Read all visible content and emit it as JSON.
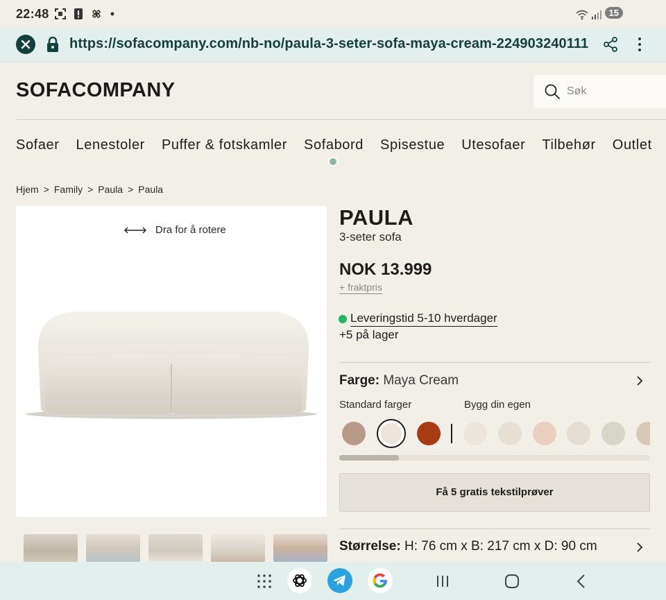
{
  "status": {
    "time": "22:48",
    "battery": "15"
  },
  "browser": {
    "url": "https://sofacompany.com/nb-no/paula-3-seter-sofa-maya-cream-224903240111"
  },
  "header": {
    "logo": "SOFACOMPANY",
    "search_placeholder": "Søk"
  },
  "nav": [
    "Sofaer",
    "Lenestoler",
    "Puffer & fotskamler",
    "Sofabord",
    "Spisestue",
    "Utesofaer",
    "Tilbehør",
    "Outlet"
  ],
  "breadcrumbs": [
    "Hjem",
    "Family",
    "Paula",
    "Paula"
  ],
  "gallery": {
    "rotate_hint": "Dra for å rotere"
  },
  "product": {
    "name": "PAULA",
    "subtitle": "3-seter sofa",
    "price": "NOK 13.999",
    "shipping": "+ fraktpris",
    "delivery": "Leveringstid 5-10 hverdager",
    "stock": "+5 på lager",
    "color_label": "Farge:",
    "color_value": "Maya Cream",
    "standard_colors_label": "Standard farger",
    "custom_colors_label": "Bygg din egen",
    "sample_button": "Få 5 gratis tekstilprøver",
    "size_label": "Størrelse:",
    "size_value": "H: 76 cm x B: 217 cm x D: 90 cm"
  },
  "swatches": {
    "standard": [
      "#b89a88",
      "#ece3da",
      "#a63b14"
    ],
    "custom": [
      "#ebe5dc",
      "#e7ded4",
      "#e8cfc0",
      "#e3ddd4",
      "#d5d6c8",
      "#d9c8b8"
    ]
  },
  "colors": {
    "accent": "#12413d",
    "in_stock": "#1fb567",
    "background": "#f2efe9"
  }
}
